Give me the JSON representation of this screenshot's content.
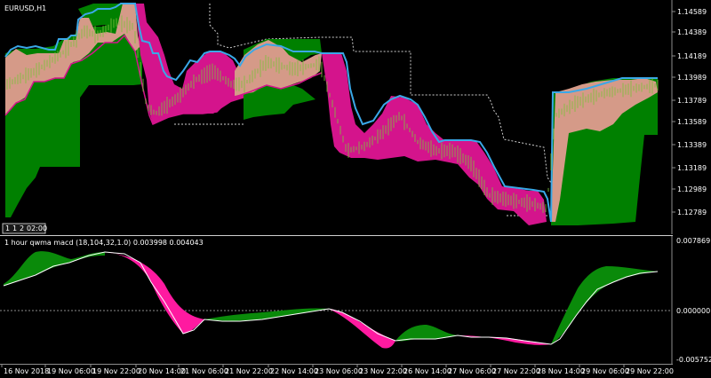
{
  "window": {
    "symbol_title": "EURUSD,H1",
    "indicator_title": "1 hour qwma macd (18,104,32,1.0) 0.003998 0.004043",
    "scale_box": [
      "1",
      "1",
      "2"
    ],
    "time_box": "02:00"
  },
  "colors": {
    "background": "#000000",
    "up_fill": "#008000",
    "down_fill": "#d4148c",
    "neutral_fill": "#d59a88",
    "channel_line": "#3aa8e8",
    "macd_up": "#0a8a0a",
    "macd_down": "#ff1aa0",
    "grid": "#8c8c8c",
    "price_bars": "#7fbf3f"
  },
  "price_axis_labels": [
    "1.14589",
    "1.14389",
    "1.14189",
    "1.13989",
    "1.13789",
    "1.13589",
    "1.13389",
    "1.13189",
    "1.12989",
    "1.12789"
  ],
  "macd_axis_labels": [
    "0.007869",
    "0.000000",
    "-0.005752"
  ],
  "time_axis_labels": [
    "16 Nov 2018",
    "19 Nov 06:00",
    "19 Nov 22:00",
    "20 Nov 14:00",
    "21 Nov 06:00",
    "21 Nov 22:00",
    "22 Nov 14:00",
    "23 Nov 06:00",
    "23 Nov 22:00",
    "26 Nov 14:00",
    "27 Nov 06:00",
    "27 Nov 22:00",
    "28 Nov 14:00",
    "29 Nov 06:00",
    "29 Nov 22:00"
  ],
  "chart_data": [
    {
      "type": "line",
      "title": "EURUSD,H1",
      "ylim": [
        1.1265,
        1.1467
      ],
      "x": [
        "16 Nov 2018",
        "19 Nov 06:00",
        "19 Nov 22:00",
        "20 Nov 14:00",
        "21 Nov 06:00",
        "21 Nov 22:00",
        "22 Nov 14:00",
        "23 Nov 06:00",
        "23 Nov 22:00",
        "26 Nov 14:00",
        "27 Nov 06:00",
        "27 Nov 22:00",
        "28 Nov 14:00",
        "29 Nov 06:00",
        "29 Nov 22:00"
      ],
      "series": [
        {
          "values": [
            1.14,
            1.144,
            1.141,
            1.1382,
            1.1405,
            1.142,
            1.1412,
            1.135,
            1.1365,
            1.1338,
            1.13,
            1.1288,
            1.1375,
            1.1395,
            1.1395
          ]
        }
      ]
    },
    {
      "type": "area",
      "title": "1 hour qwma macd (18,104,32,1.0) 0.003998 0.004043",
      "ylim": [
        -0.005752,
        0.007869
      ],
      "x": [
        "16 Nov 2018",
        "19 Nov 06:00",
        "19 Nov 22:00",
        "20 Nov 14:00",
        "21 Nov 06:00",
        "21 Nov 22:00",
        "22 Nov 14:00",
        "23 Nov 06:00",
        "23 Nov 22:00",
        "26 Nov 14:00",
        "27 Nov 06:00",
        "27 Nov 22:00",
        "28 Nov 14:00",
        "29 Nov 06:00",
        "29 Nov 22:00"
      ],
      "series": [
        {
          "values": [
            0.0035,
            0.0058,
            0.0052,
            -0.0005,
            -0.002,
            -0.0005,
            0.0002,
            -0.003,
            -0.004,
            -0.0025,
            -0.003,
            -0.0038,
            -0.002,
            0.0035,
            0.004
          ]
        }
      ]
    }
  ]
}
